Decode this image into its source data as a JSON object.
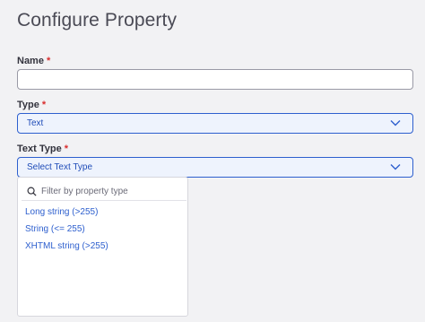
{
  "page": {
    "title": "Configure Property"
  },
  "name_field": {
    "label": "Name",
    "required_marker": "*",
    "value": ""
  },
  "type_field": {
    "label": "Type",
    "required_marker": "*",
    "selected": "Text"
  },
  "text_type_field": {
    "label": "Text Type",
    "required_marker": "*",
    "selected": "Select Text Type"
  },
  "dropdown": {
    "filter_placeholder": "Filter by property type",
    "options": [
      {
        "label": "Long string (>255)"
      },
      {
        "label": "String (<= 255)"
      },
      {
        "label": "XHTML string (>255)"
      }
    ]
  },
  "colors": {
    "accent": "#2d5fce",
    "required": "#d92d2d",
    "select_bg": "#eef3fd"
  },
  "icons": {
    "search": "search-icon",
    "chevron": "chevron-down-icon"
  }
}
